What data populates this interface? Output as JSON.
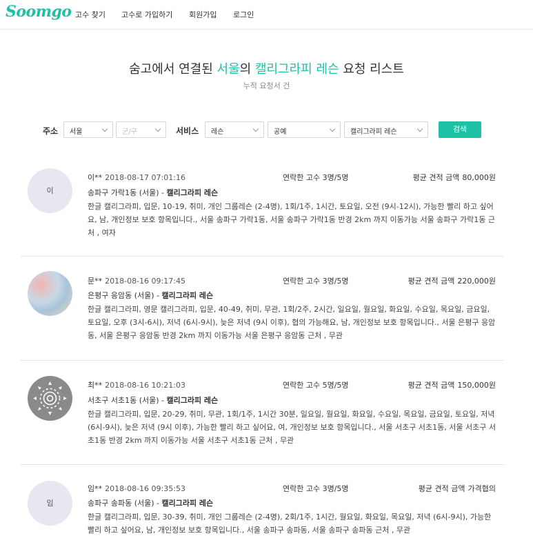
{
  "header": {
    "logo": "Soomgo",
    "nav": [
      "고수 찾기",
      "고수로 가입하기",
      "회원가입",
      "로그인"
    ]
  },
  "title": {
    "prefix": "숨고에서 연결된 ",
    "region": "서울",
    "mid": "의 ",
    "service": "캘리그라피 레슨",
    "suffix": " 요청 리스트",
    "subtitle": "누적 요청서 건"
  },
  "filters": {
    "address_label": "주소",
    "city": "서울",
    "district_placeholder": "군/구",
    "service_label": "서비스",
    "category": "레슨",
    "subcategory": "공예",
    "service": "캘리그라피 레슨",
    "search_label": "검색"
  },
  "labels": {
    "contacted": "연락한 고수",
    "estimate": "평균 견적 금액"
  },
  "requests": [
    {
      "avatar_text": "이",
      "name": "이**",
      "date": "2018-08-17 07:01:16",
      "contacted": "3명/5명",
      "price": "80,000원",
      "location": "송파구 가락1동 (서울) - ",
      "service": "캘리그라피 레슨",
      "desc": "한글 캘리그라피, 입문, 10-19, 취미, 개인 그룹레슨 (2-4명), 1회/1주, 1시간, 토요일, 오전 (9시-12시), 가능한 빨리 하고 싶어요, 남, 개인정보 보호 항목입니다., 서울 송파구 가락1동, 서울 송파구 가락1동 반경 2km 까지 이동가능 서울 송파구 가락1동 근처 , 여자"
    },
    {
      "avatar_text": "",
      "name": "문**",
      "date": "2018-08-16 09:17:45",
      "contacted": "3명/5명",
      "price": "220,000원",
      "location": "은평구 응암동 (서울) - ",
      "service": "캘리그라피 레슨",
      "desc": "한글 캘리그라피, 영문 캘리그라피, 입문, 40-49, 취미, 무관, 1회/2주, 2시간, 일요일, 월요일, 화요일, 수요일, 목요일, 금요일, 토요일, 오후 (3시-6시), 저녁 (6시-9시), 늦은 저녁 (9시 이후), 협의 가능해요, 남, 개인정보 보호 항목입니다., 서울 은평구 응암동, 서울 은평구 응암동 반경 2km 까지 이동가능 서울 은평구 응암동 근처 , 무관"
    },
    {
      "avatar_text": "",
      "name": "최**",
      "date": "2018-08-16 10:21:03",
      "contacted": "5명/5명",
      "price": "150,000원",
      "location": "서초구 서초1동 (서울) - ",
      "service": "캘리그라피 레슨",
      "desc": "한글 캘리그라피, 입문, 20-29, 취미, 무관, 1회/1주, 1시간 30분, 일요일, 월요일, 화요일, 수요일, 목요일, 금요일, 토요일, 저녁 (6시-9시), 늦은 저녁 (9시 이후), 가능한 빨리 하고 싶어요, 여, 개인정보 보호 항목입니다., 서울 서초구 서초1동, 서울 서초구 서초1동 반경 2km 까지 이동가능 서울 서초구 서초1동 근처 , 무관"
    },
    {
      "avatar_text": "임",
      "name": "임**",
      "date": "2018-08-16 09:35:53",
      "contacted": "3명/5명",
      "price": "가격협의",
      "location": "송파구 송파동 (서울) - ",
      "service": "캘리그라피 레슨",
      "desc": "한글 캘리그라피, 입문, 30-39, 취미, 개인 그룹레슨 (2-4명), 2회/1주, 1시간, 월요일, 화요일, 목요일, 저녁 (6시-9시), 가능한 빨리 하고 싶어요, 남, 개인정보 보호 항목입니다., 서울 송파구 송파동, 서울 송파구 송파동 근처 , 무관"
    }
  ]
}
